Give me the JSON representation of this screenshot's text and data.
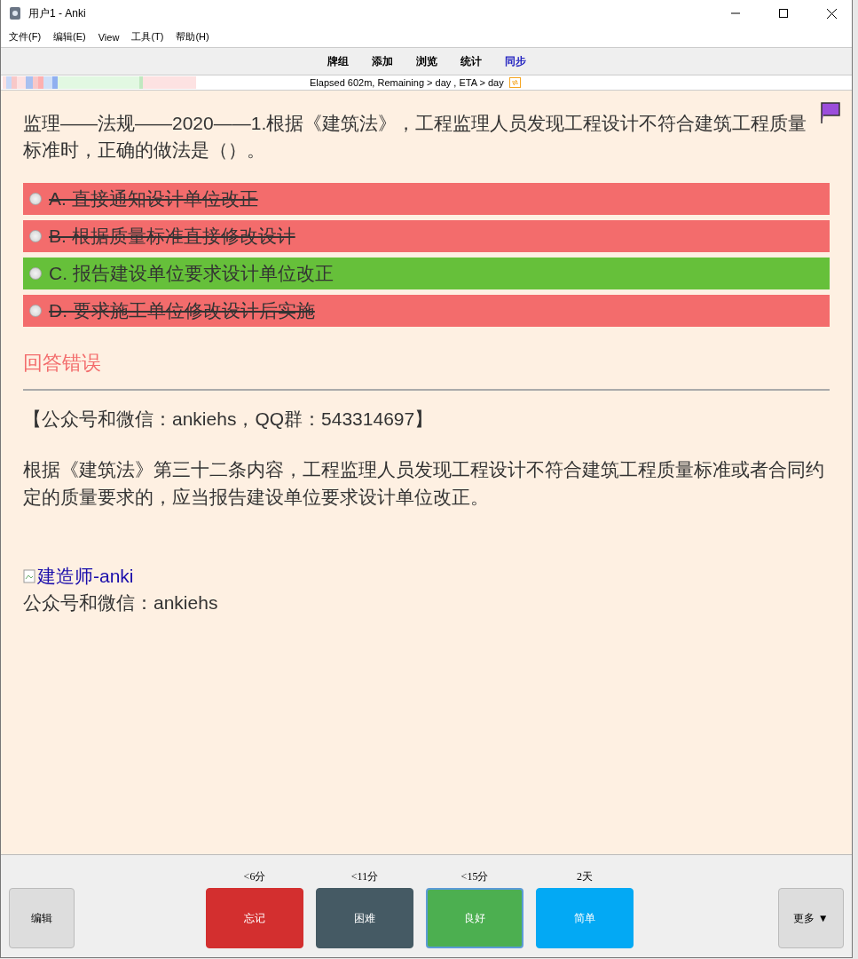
{
  "window": {
    "title": "用户1 - Anki"
  },
  "menu": [
    "文件(F)",
    "编辑(E)",
    "View",
    "工具(T)",
    "帮助(H)"
  ],
  "toolbar": [
    {
      "label": "牌组",
      "selected": false
    },
    {
      "label": "添加",
      "selected": false
    },
    {
      "label": "浏览",
      "selected": false
    },
    {
      "label": "统计",
      "selected": false
    },
    {
      "label": "同步",
      "selected": true
    }
  ],
  "progress": {
    "text": "Elapsed 602m, Remaining > day , ETA > day"
  },
  "card": {
    "flagged": true,
    "question": "监理——法规——2020——1.根据《建筑法》，工程监理人员发现工程设计不符合建筑工程质量标准时，正确的做法是（）。",
    "options": [
      {
        "label": "A. 直接通知设计单位改正",
        "kind": "wrong"
      },
      {
        "label": "B. 根据质量标准直接修改设计",
        "kind": "wrong"
      },
      {
        "label": "C. 报告建设单位要求设计单位改正",
        "kind": "correct"
      },
      {
        "label": "D. 要求施工单位修改设计后实施",
        "kind": "wrong"
      }
    ],
    "result": "回答错误",
    "contact": "【公众号和微信：ankiehs，QQ群：543314697】",
    "explanation": "根据《建筑法》第三十二条内容，工程监理人员发现工程设计不符合建筑工程质量标准或者合同约定的质量要求的，应当报告建设单位要求设计单位改正。",
    "image_alt": "建造师-anki",
    "footer": "公众号和微信：ankiehs"
  },
  "bottom": {
    "edit": "编辑",
    "more": "更多 ▼",
    "answers": [
      {
        "interval": "<6分",
        "label": "忘记",
        "color": "#d32f2f",
        "selected": false
      },
      {
        "interval": "<11分",
        "label": "困难",
        "color": "#455a64",
        "selected": false
      },
      {
        "interval": "<15分",
        "label": "良好",
        "color": "#4caf50",
        "selected": true
      },
      {
        "interval": "2天",
        "label": "简单",
        "color": "#03a9f4",
        "selected": false
      }
    ]
  }
}
